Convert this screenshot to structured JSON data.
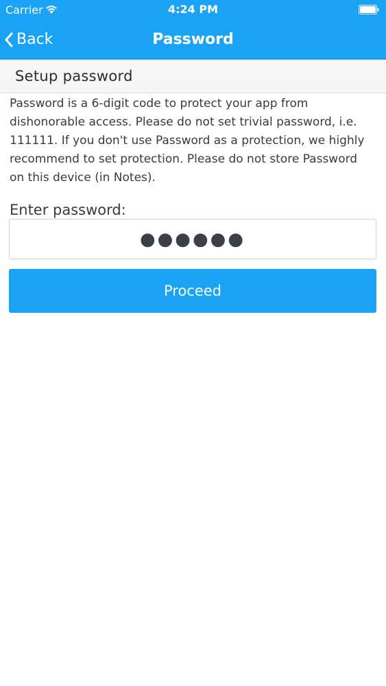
{
  "status_bar": {
    "carrier": "Carrier",
    "time": "4:24 PM",
    "icons": [
      "wifi-icon",
      "battery-icon"
    ]
  },
  "nav": {
    "back_label": "Back",
    "title": "Password"
  },
  "section": {
    "title": "Setup password"
  },
  "description": "Password is a 6-digit code to protect your app from dishonorable access. Please do not set trivial password, i.e. 111111. If you don't use Password as a protection, we highly recommend to set protection. Please do not store Password on this device (in Notes).",
  "form": {
    "label": "Enter password:",
    "masked_value": "●●●●●●",
    "button_label": "Proceed"
  },
  "colors": {
    "accent": "#1aa3f5",
    "section_bg": "#f6f6f8",
    "text": "#3a3a3c"
  }
}
